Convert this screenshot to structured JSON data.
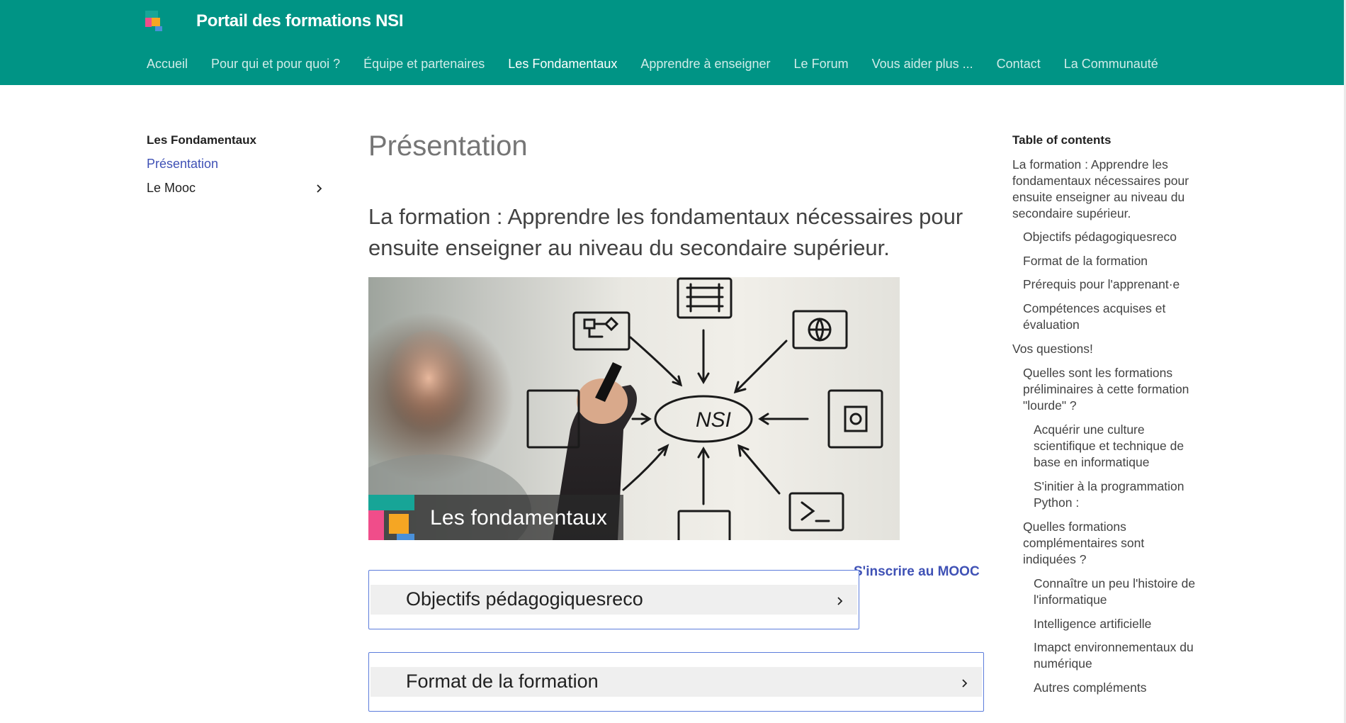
{
  "header": {
    "site_title": "Portail des formations NSI",
    "nav": [
      {
        "label": "Accueil"
      },
      {
        "label": "Pour qui et pour quoi ?"
      },
      {
        "label": "Équipe et partenaires"
      },
      {
        "label": "Les Fondamentaux",
        "active": true
      },
      {
        "label": "Apprendre à enseigner"
      },
      {
        "label": "Le Forum"
      },
      {
        "label": "Vous aider plus ..."
      },
      {
        "label": "Contact"
      },
      {
        "label": "La Communauté"
      }
    ],
    "colors": {
      "bar": "#009485",
      "logo": [
        "#1aa394",
        "#f04d8a",
        "#f5a623",
        "#4a90d9"
      ]
    }
  },
  "sidebar": {
    "title": "Les Fondamentaux",
    "items": [
      {
        "label": "Présentation",
        "active": true
      },
      {
        "label": "Le Mooc",
        "icon": "chevron-right-icon"
      }
    ]
  },
  "main": {
    "title": "Présentation",
    "section_heading": "La formation : Apprendre les fondamentaux nécessaires pour ensuite enseigner au niveau du secondaire supérieur.",
    "hero": {
      "center_label": "NSI",
      "caption": "Les fondamentaux",
      "icons": [
        "flowchart-icon",
        "abacus-icon",
        "globe-icon",
        "box-icon",
        "chip-icon",
        "terminal-icon"
      ]
    },
    "subscribe_link": "S'inscrire au MOOC",
    "accordions": [
      {
        "label": "Objectifs pédagogiquesreco"
      },
      {
        "label": "Format de la formation"
      }
    ],
    "accent": "#3f51b5"
  },
  "toc": {
    "title": "Table of contents",
    "items": [
      {
        "label": "La formation : Apprendre les fondamentaux nécessaires pour ensuite enseigner au niveau du secondaire supérieur.",
        "level": 1
      },
      {
        "label": "Objectifs pédagogiquesreco",
        "level": 2
      },
      {
        "label": "Format de la formation",
        "level": 2
      },
      {
        "label": "Prérequis pour l'apprenant·e",
        "level": 2
      },
      {
        "label": "Compétences acquises et évaluation",
        "level": 2
      },
      {
        "label": "Vos questions!",
        "level": 1
      },
      {
        "label": "Quelles sont les formations préliminaires à cette formation \"lourde\" ?",
        "level": 2
      },
      {
        "label": "Acquérir une culture scientifique et technique de base en informatique",
        "level": 3
      },
      {
        "label": "S'initier à la programmation Python :",
        "level": 3
      },
      {
        "label": "Quelles formations complémentaires sont indiquées ?",
        "level": 2
      },
      {
        "label": "Connaître un peu l'histoire de l'informatique",
        "level": 3
      },
      {
        "label": "Intelligence artificielle",
        "level": 3
      },
      {
        "label": "Imapct environnementaux du numérique",
        "level": 3
      },
      {
        "label": "Autres compléments",
        "level": 3
      }
    ]
  }
}
